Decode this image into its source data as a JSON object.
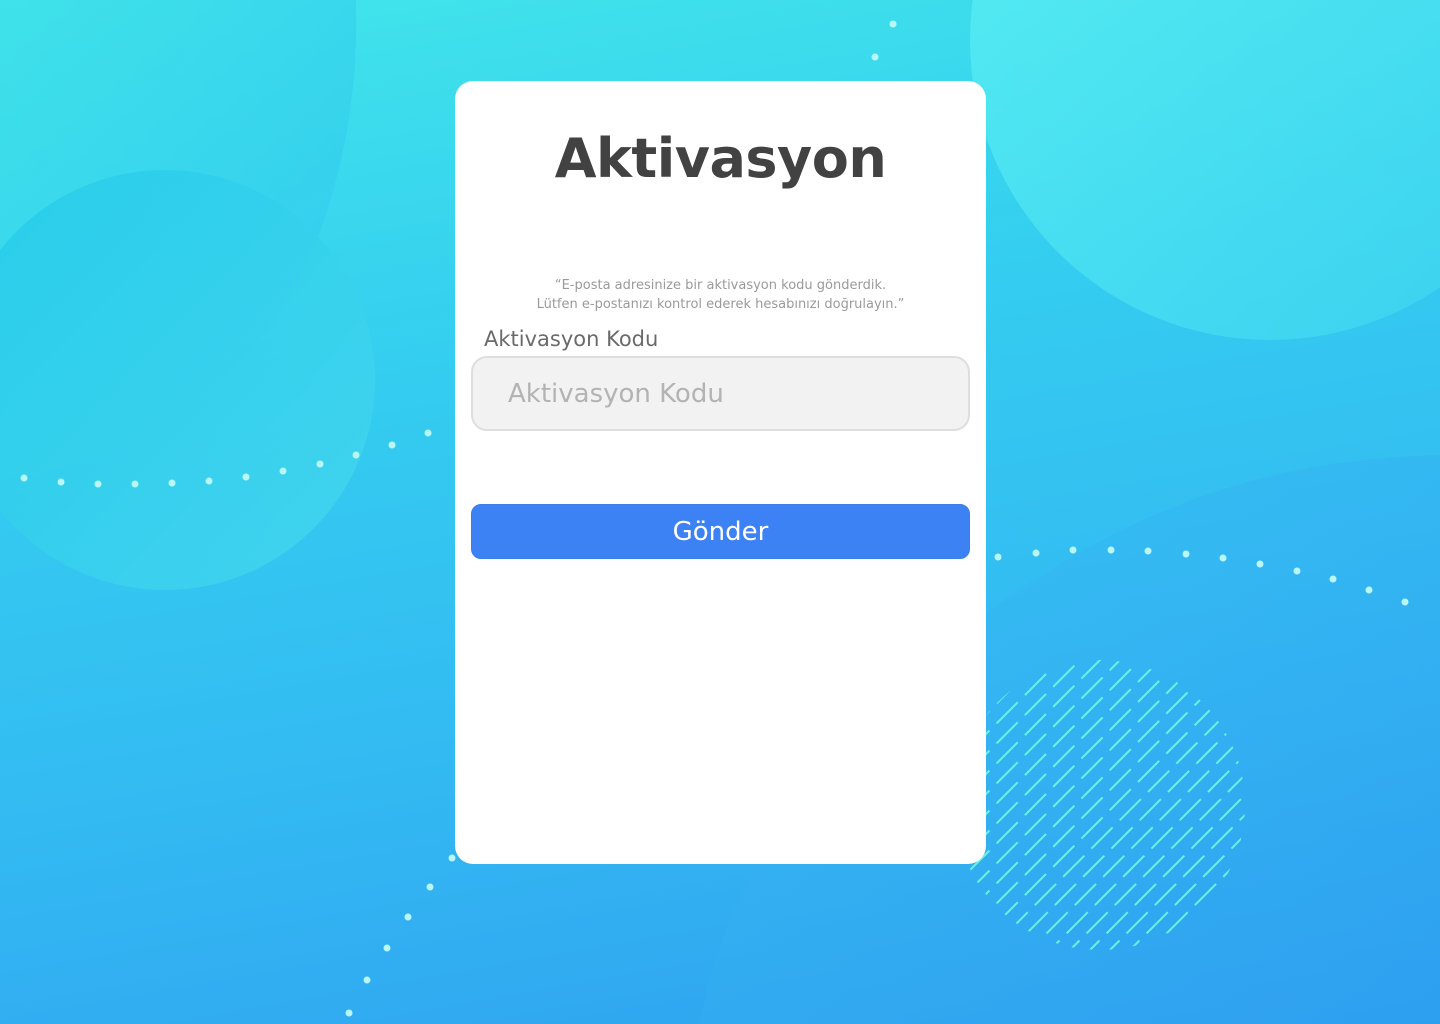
{
  "page": {
    "title": "Aktivasyon"
  },
  "notice": {
    "line1": "“E-posta adresinize bir aktivasyon kodu gönderdik.",
    "line2": "Lütfen e-postanızı kontrol ederek hesabınızı doğrulayın.”"
  },
  "form": {
    "code_label": "Aktivasyon Kodu",
    "code_placeholder": "Aktivasyon Kodu",
    "code_value": "",
    "submit_label": "Gönder"
  },
  "colors": {
    "background_top": "#42e6ea",
    "background_bottom": "#2f9ff0",
    "card": "#ffffff",
    "title": "#424242",
    "button": "#3d82f5",
    "input_background": "#f2f2f2"
  }
}
